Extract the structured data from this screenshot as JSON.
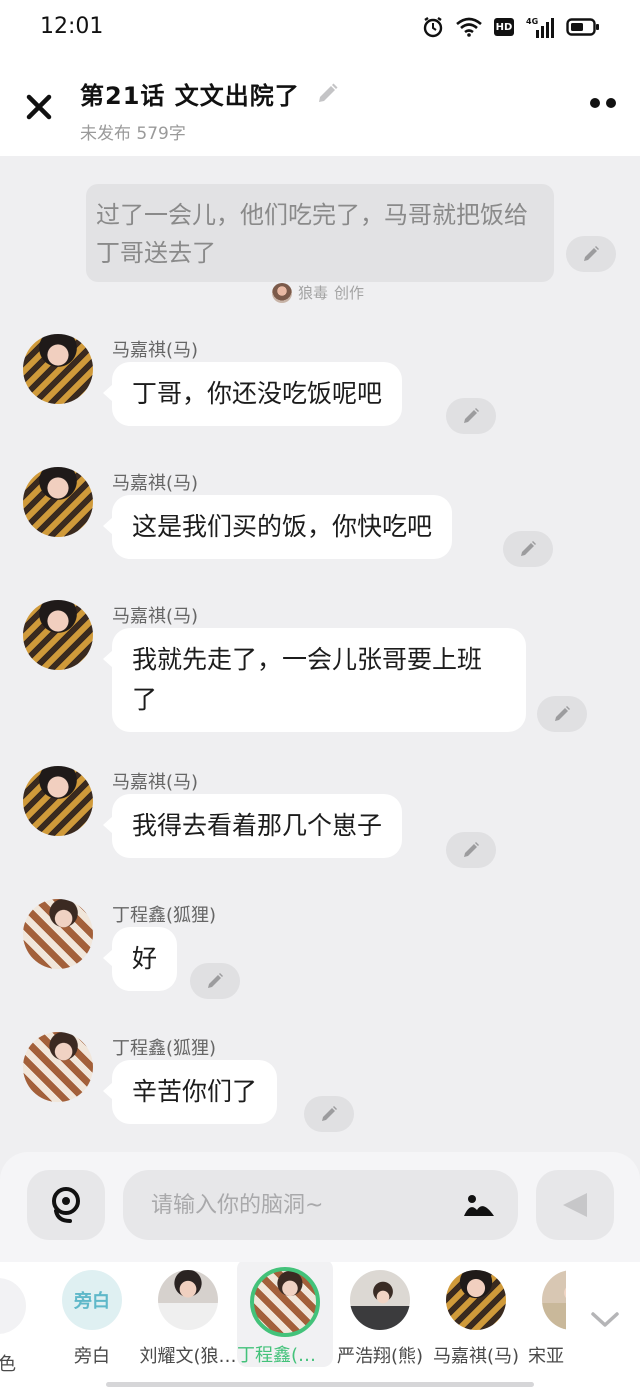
{
  "status_bar": {
    "time": "12:01",
    "hd_label": "HD",
    "network_label": "4G"
  },
  "header": {
    "title": "第21话   文文出院了",
    "subtitle": "未发布 579字"
  },
  "narration": {
    "text": "过了一会儿，他们吃完了，马哥就把饭给丁哥送去了",
    "credit_name": "狼毒",
    "credit_action": "创作"
  },
  "messages": [
    {
      "speaker": "马嘉祺(马)",
      "text": "丁哥，你还没吃饭呢吧"
    },
    {
      "speaker": "马嘉祺(马)",
      "text": "这是我们买的饭，你快吃吧"
    },
    {
      "speaker": "马嘉祺(马)",
      "text": "我就先走了，一会儿张哥要上班了"
    },
    {
      "speaker": "马嘉祺(马)",
      "text": "我得去看着那几个崽子"
    },
    {
      "speaker": "丁程鑫(狐狸)",
      "text": "好"
    },
    {
      "speaker": "丁程鑫(狐狸)",
      "text": "辛苦你们了"
    }
  ],
  "input": {
    "placeholder": "请输入你的脑洞~"
  },
  "characters": {
    "partial_left": "角色",
    "narrator_badge": "旁白",
    "items": [
      {
        "name": "旁白"
      },
      {
        "name": "刘耀文(狼…"
      },
      {
        "name": "丁程鑫(狐…"
      },
      {
        "name": "严浩翔(熊)"
      },
      {
        "name": "马嘉祺(马)"
      },
      {
        "name": "宋亚"
      }
    ]
  },
  "colors": {
    "accent_green": "#43c27a",
    "bubble": "#ffffff",
    "background": "#efeff1"
  }
}
